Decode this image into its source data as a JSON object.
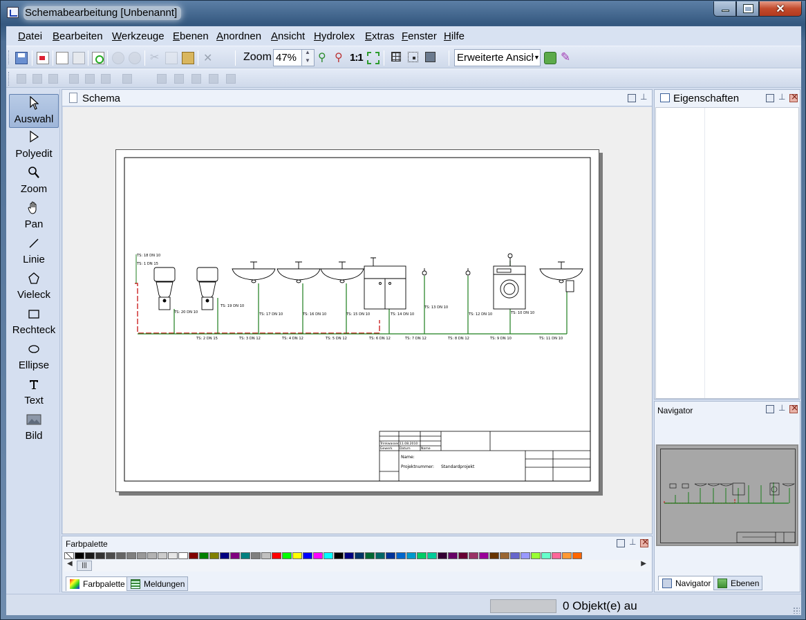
{
  "window": {
    "title": "Schemabearbeitung [Unbenannt]"
  },
  "menu": [
    "Datei",
    "Bearbeiten",
    "Werkzeuge",
    "Ebenen",
    "Anordnen",
    "Ansicht",
    "Hydrolex",
    "Extras",
    "Fenster",
    "Hilfe"
  ],
  "toolbar": {
    "zoom_label": "Zoom",
    "zoom_value": "47%",
    "one_to_one": "1:1",
    "view_select": "Erweiterte Ansicht"
  },
  "tools": [
    {
      "label": "Auswahl",
      "icon": "select-arrow-icon",
      "active": true
    },
    {
      "label": "Polyedit",
      "icon": "polyedit-arrow-icon",
      "active": false
    },
    {
      "label": "Zoom",
      "icon": "magnifier-icon",
      "active": false
    },
    {
      "label": "Pan",
      "icon": "hand-icon",
      "active": false
    },
    {
      "label": "Linie",
      "icon": "line-icon",
      "active": false
    },
    {
      "label": "Vieleck",
      "icon": "pentagon-icon",
      "active": false
    },
    {
      "label": "Rechteck",
      "icon": "rectangle-icon",
      "active": false
    },
    {
      "label": "Ellipse",
      "icon": "ellipse-icon",
      "active": false
    },
    {
      "label": "Text",
      "icon": "text-icon",
      "active": false
    },
    {
      "label": "Bild",
      "icon": "image-icon",
      "active": false
    }
  ],
  "schema": {
    "tab_title": "Schema",
    "drawing": {
      "labels_top": [
        "TS: 18 DN 10",
        "TS: 1 DN 15"
      ],
      "labels_riser": [
        "TS: 20 DN 10",
        "TS: 19 DN 10",
        "TS: 17 DN 10",
        "TS: 16 DN 10",
        "TS: 15 DN 10",
        "TS: 14 DN 10",
        "TS: 13 DN 10",
        "TS: 12 DN 10",
        "TS: 10 DN 10"
      ],
      "labels_main": [
        "TS: 2 DN 15",
        "TS: 3 DN 12",
        "TS: 4 DN 12",
        "TS: 5 DN 12",
        "TS: 6 DN 12",
        "TS: 7 DN 12",
        "TS: 8 DN 12",
        "TS: 9 DN 10",
        "TS: 11 DN 10"
      ],
      "titleblock": {
        "gewerk_value": "Trinkwasser",
        "datum_value": "11.08.2010",
        "gewerk_label": "Gewerk",
        "datum_label": "Datum",
        "name_label": "Name",
        "name_field": "Name:",
        "project_label": "Projektnummer:",
        "project_value": "Standardprojekt"
      }
    }
  },
  "palette": {
    "title": "Farbpalette",
    "colors": [
      "#ffffff",
      "#000000",
      "#1a1a1a",
      "#333333",
      "#4d4d4d",
      "#666666",
      "#808080",
      "#999999",
      "#b3b3b3",
      "#cccccc",
      "#e6e6e6",
      "#ffffff",
      "#800000",
      "#008000",
      "#808000",
      "#000080",
      "#800080",
      "#008080",
      "#808080",
      "#c0c0c0",
      "#ff0000",
      "#00ff00",
      "#ffff00",
      "#0000ff",
      "#ff00ff",
      "#00ffff",
      "#000000",
      "#000080",
      "#003366",
      "#006633",
      "#006666",
      "#003399",
      "#0066cc",
      "#0099cc",
      "#00cc66",
      "#00cc99",
      "#330033",
      "#660066",
      "#660033",
      "#993366",
      "#990099",
      "#663300",
      "#996633",
      "#6666cc",
      "#9999ff",
      "#99ff33",
      "#66ffcc",
      "#ff6699",
      "#ff9933",
      "#ff6600"
    ],
    "tabs": [
      "Farbpalette",
      "Meldungen"
    ]
  },
  "properties": {
    "title": "Eigenschaften"
  },
  "navigator": {
    "title": "Navigator",
    "tabs": [
      "Navigator",
      "Ebenen"
    ]
  },
  "status": {
    "text": "0 Objekt(e) au"
  },
  "colors": {
    "pipe_green": "#1c7d1c",
    "pipe_red": "#cc2222",
    "accent_blue": "#3b5f86"
  }
}
